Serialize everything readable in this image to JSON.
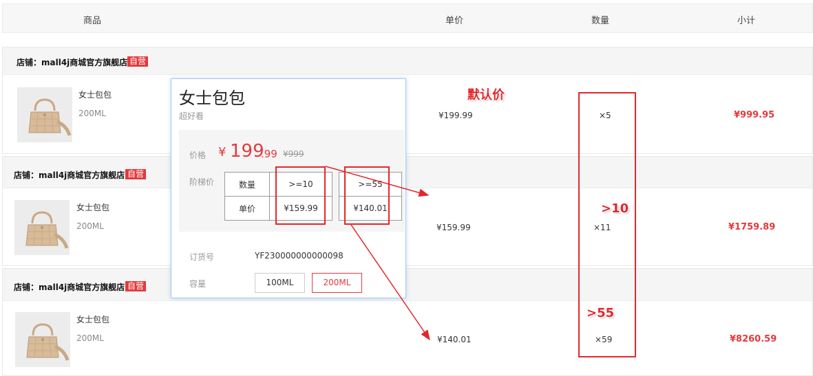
{
  "header": {
    "product": "商品",
    "unit_price": "单价",
    "quantity": "数量",
    "subtotal": "小计"
  },
  "shops": [
    {
      "shop_label": "店铺：mall4j商城官方旗舰店",
      "badge": "自营",
      "item": {
        "name": "女士包包",
        "spec": "200ML",
        "price": "¥199.99",
        "qty": "×5",
        "subtotal": "¥999.95"
      }
    },
    {
      "shop_label": "店铺：mall4j商城官方旗舰店",
      "badge": "自营",
      "item": {
        "name": "女士包包",
        "spec": "200ML",
        "price": "¥159.99",
        "qty": "×11",
        "subtotal": "¥1759.89"
      }
    },
    {
      "shop_label": "店铺：mall4j商城官方旗舰店",
      "badge": "自营",
      "item": {
        "name": "女士包包",
        "spec": "200ML",
        "price": "¥140.01",
        "qty": "×59",
        "subtotal": "¥8260.59"
      }
    }
  ],
  "popup": {
    "title": "女士包包",
    "subtitle": "超好看",
    "price_label": "价格",
    "price_symbol": "¥",
    "price_int": "199",
    "price_dec": ".99",
    "original_price": "¥999",
    "tier_label": "阶梯价",
    "tier_table": {
      "row1": [
        "数量",
        ">=10",
        ">=55"
      ],
      "row2": [
        "单价",
        "¥159.99",
        "¥140.01"
      ]
    },
    "order_no_label": "订货号",
    "order_no": "YF230000000000098",
    "capacity_label": "容量",
    "capacity_options": [
      "100ML",
      "200ML"
    ],
    "capacity_selected": "200ML"
  },
  "annotations": {
    "default_price": "默认价",
    "gt10": ">10",
    "gt55": ">55"
  },
  "colors": {
    "accent_red": "#e4393c",
    "annotation_red": "#e4262b",
    "popup_border": "#a8c8ef"
  }
}
